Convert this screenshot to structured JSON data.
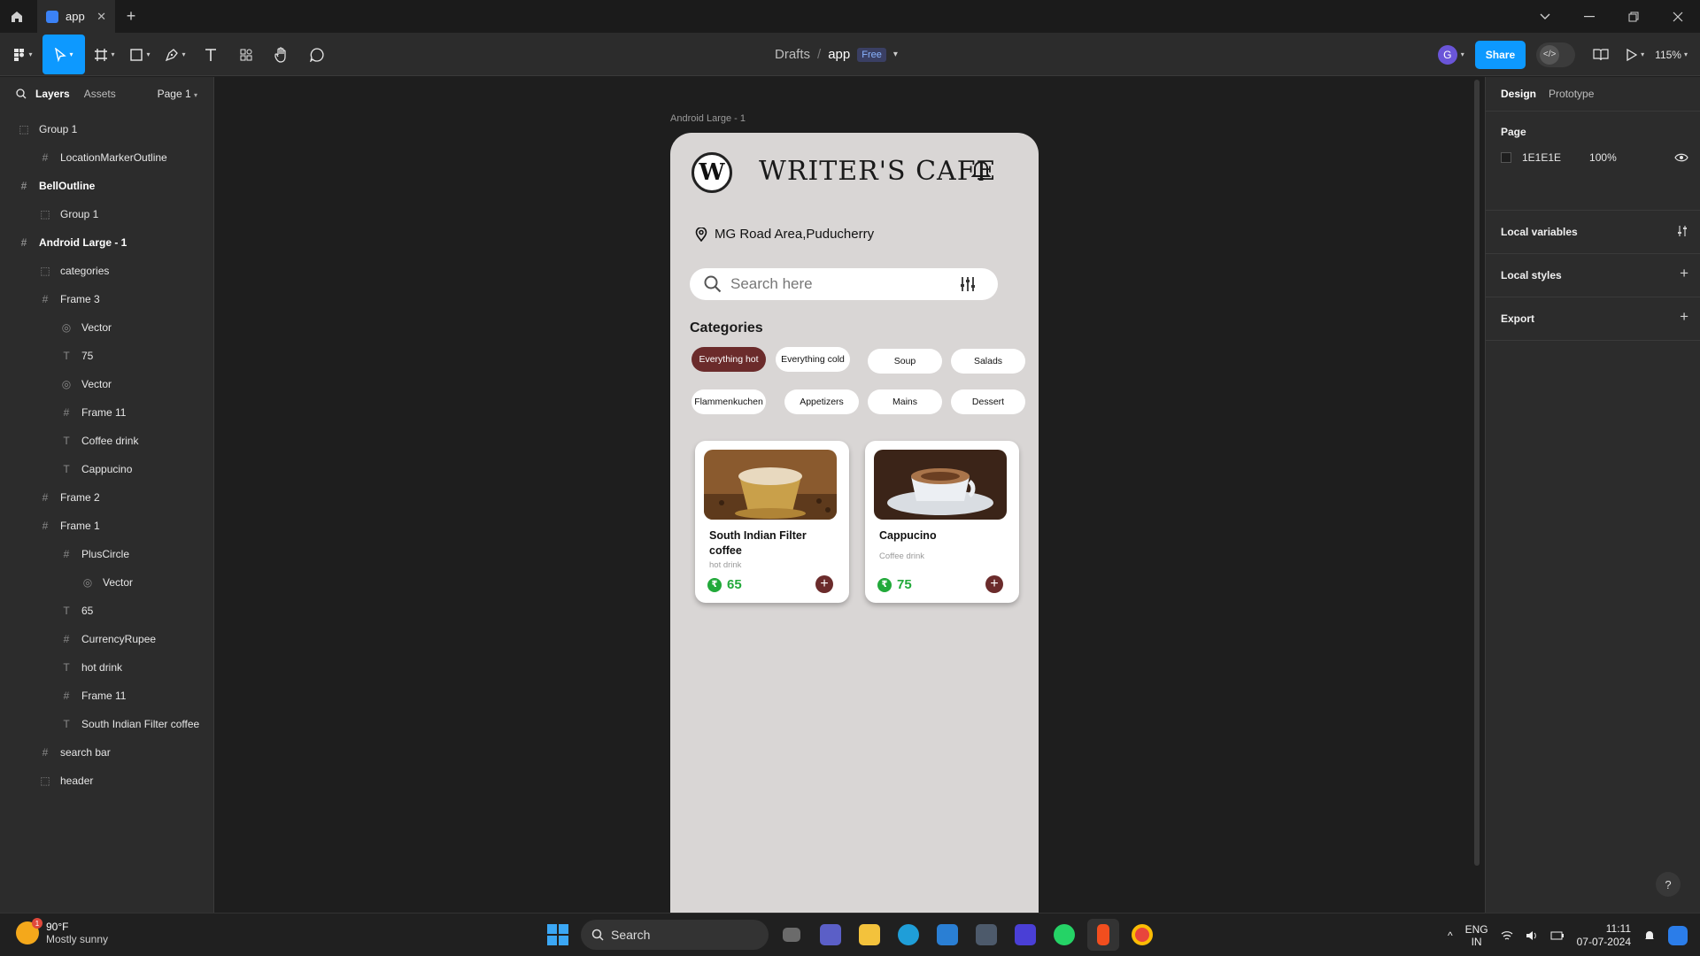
{
  "tabbar": {
    "tab_label": "app",
    "tab_close": "✕",
    "new_tab": "+"
  },
  "toolbar": {
    "breadcrumb_root": "Drafts",
    "breadcrumb_sep": "/",
    "file_name": "app",
    "plan_badge": "Free",
    "user_initial": "G",
    "share_label": "Share",
    "zoom": "115%"
  },
  "left_panel": {
    "tab_layers": "Layers",
    "tab_assets": "Assets",
    "page_select": "Page 1",
    "layers": [
      {
        "name": "Group 1",
        "icon": "group"
      },
      {
        "name": "LocationMarkerOutline",
        "icon": "frame"
      },
      {
        "name": "BellOutline",
        "icon": "frame"
      },
      {
        "name": "Group 1",
        "icon": "group"
      },
      {
        "name": "Android Large - 1",
        "icon": "frame"
      },
      {
        "name": "categories",
        "icon": "group"
      },
      {
        "name": "Frame 3",
        "icon": "frame"
      },
      {
        "name": "Vector",
        "icon": "vector"
      },
      {
        "name": "75",
        "icon": "text"
      },
      {
        "name": "Vector",
        "icon": "vector"
      },
      {
        "name": "Frame 11",
        "icon": "frame"
      },
      {
        "name": "Coffee drink",
        "icon": "text"
      },
      {
        "name": "Cappucino",
        "icon": "text"
      },
      {
        "name": "Frame 2",
        "icon": "frame"
      },
      {
        "name": "Frame 1",
        "icon": "frame"
      },
      {
        "name": "PlusCircle",
        "icon": "frame"
      },
      {
        "name": "Vector",
        "icon": "vector"
      },
      {
        "name": "65",
        "icon": "text"
      },
      {
        "name": "CurrencyRupee",
        "icon": "frame"
      },
      {
        "name": "hot drink",
        "icon": "text"
      },
      {
        "name": "Frame 11",
        "icon": "frame"
      },
      {
        "name": "South Indian Filter coffee",
        "icon": "text"
      },
      {
        "name": "search bar",
        "icon": "frame"
      },
      {
        "name": "header",
        "icon": "group"
      }
    ]
  },
  "canvas": {
    "frame_label": "Android Large - 1",
    "app": {
      "brand": "WRITER'S CAFE",
      "logo_letter": "W",
      "location": "MG Road Area,Puducherry",
      "search_placeholder": "Search here",
      "categories_title": "Categories",
      "categories": [
        "Everything hot",
        "Everything cold",
        "Soup",
        "Salads",
        "Flammenkuchen",
        "Appetizers",
        "Mains",
        "Dessert"
      ],
      "active_category": "Everything hot",
      "products": [
        {
          "title": "South Indian Filter coffee",
          "subtitle": "hot drink",
          "price": "65",
          "plus": "+"
        },
        {
          "title": "Cappucino",
          "subtitle": "Coffee drink",
          "price": "75",
          "plus": "+"
        }
      ],
      "rupee_symbol": "₹"
    }
  },
  "right_panel": {
    "tab_design": "Design",
    "tab_prototype": "Prototype",
    "page_section": "Page",
    "page_color": "1E1E1E",
    "page_opacity": "100%",
    "local_variables": "Local variables",
    "local_styles": "Local styles",
    "export": "Export",
    "plus": "+",
    "help": "?"
  },
  "taskbar": {
    "temperature": "90°F",
    "weather": "Mostly sunny",
    "weather_badge": "1",
    "search_label": "Search",
    "lang_top": "ENG",
    "lang_bottom": "IN",
    "time": "11:11",
    "date": "07-07-2024"
  },
  "colors": {
    "accent": "#0d99ff",
    "brand_maroon": "#6b2b2b",
    "price_green": "#22a93a",
    "frame_bg": "#d9d6d5",
    "canvas_bg": "#1e1e1e"
  }
}
